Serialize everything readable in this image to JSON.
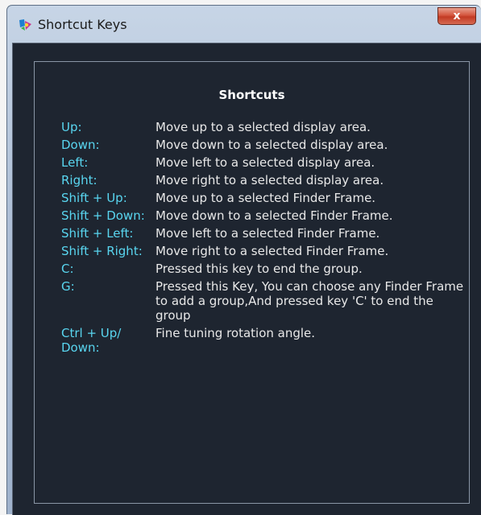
{
  "window": {
    "title": "Shortcut Keys",
    "close_label": "x",
    "icon": "app-icon"
  },
  "dialog": {
    "heading": "Shortcuts",
    "shortcuts": [
      {
        "key": "Up:",
        "desc": "Move up to a selected display area."
      },
      {
        "key": "Down:",
        "desc": "Move down to a selected display area."
      },
      {
        "key": "Left:",
        "desc": "Move left to a selected display area."
      },
      {
        "key": "Right:",
        "desc": "Move right to a selected display area."
      },
      {
        "key": "Shift + Up:",
        "desc": "Move up to a selected Finder Frame."
      },
      {
        "key": "Shift + Down:",
        "desc": "Move down to a selected Finder Frame."
      },
      {
        "key": "Shift + Left:",
        "desc": "Move left to a selected Finder Frame."
      },
      {
        "key": "Shift + Right:",
        "desc": "Move right to a selected Finder Frame."
      },
      {
        "key": "C:",
        "desc": "Pressed this key to end the group."
      },
      {
        "key": "G:",
        "desc": "Pressed this Key, You can choose any Finder Frame to add a group,And pressed key 'C' to end the group"
      },
      {
        "key": "Ctrl + Up/ Down:",
        "desc": "Fine tuning rotation angle."
      }
    ]
  },
  "colors": {
    "background": "#1e2530",
    "key_text": "#59d6f0",
    "desc_text": "#e8e8e8",
    "heading_text": "#ffffff"
  }
}
